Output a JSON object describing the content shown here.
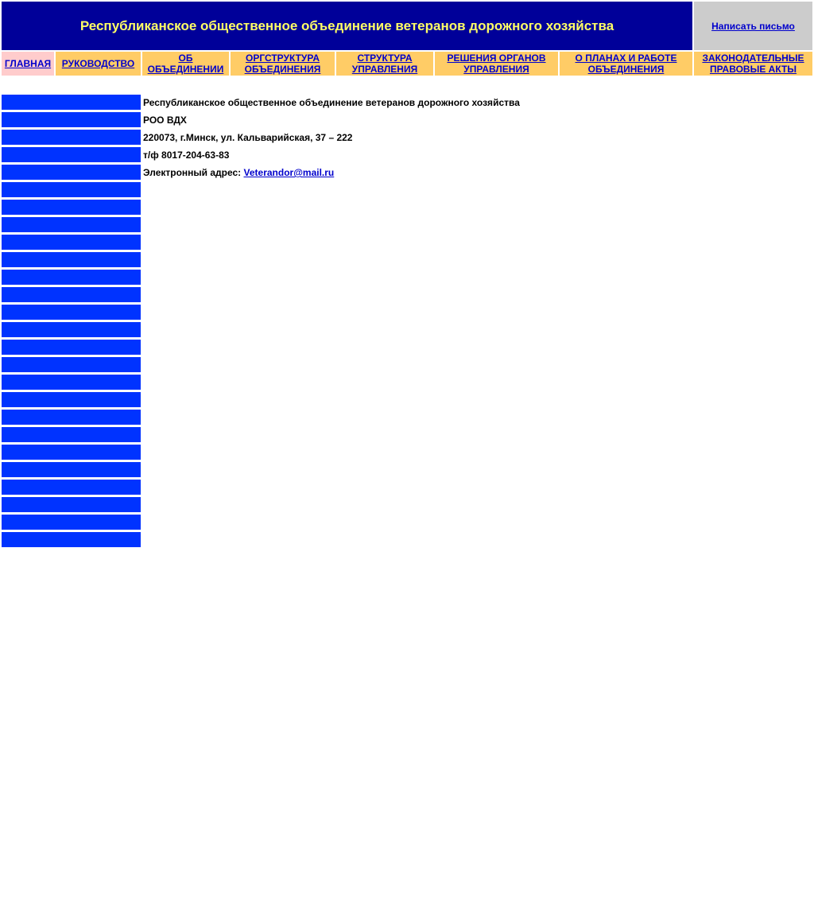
{
  "header": {
    "title": "Республиканское общественное объединение ветеранов дорожного хозяйства",
    "mail_link": "Написать письмо"
  },
  "nav": {
    "items": [
      {
        "label": "ГЛАВНАЯ"
      },
      {
        "label": "РУКОВОДСТВО"
      },
      {
        "label": "ОБ ОБЪЕДИНЕНИИ"
      },
      {
        "label": "ОРГСТРУКТУРА ОБЪЕДИНЕНИЯ"
      },
      {
        "label": "СТРУКТУРА УПРАВЛЕНИЯ"
      },
      {
        "label": "РЕШЕНИЯ ОРГАНОВ УПРАВЛЕНИЯ"
      },
      {
        "label": "О ПЛАНАХ И РАБОТЕ ОБЪЕДИНЕНИЯ"
      },
      {
        "label": "ЗАКОНОДАТЕЛЬНЫЕ ПРАВОВЫЕ АКТЫ"
      }
    ]
  },
  "content": {
    "org_name": "Республиканское общественное объединение ветеранов дорожного хозяйства",
    "abbr": "РОО ВДХ",
    "address": "220073, г.Минск, ул. Кальварийская, 37 – 222",
    "phone": "т/ф 8017-204-63-83",
    "email_label": "Электронный адрес: ",
    "email": "Veterandor@mail.ru"
  },
  "colors": {
    "title_bg": "#000099",
    "title_text": "#ffff66",
    "nav_bg": "#ffcc66",
    "nav_active_bg": "#ffcccc",
    "sidebar_block": "#0033ff",
    "link": "#0000cc"
  }
}
